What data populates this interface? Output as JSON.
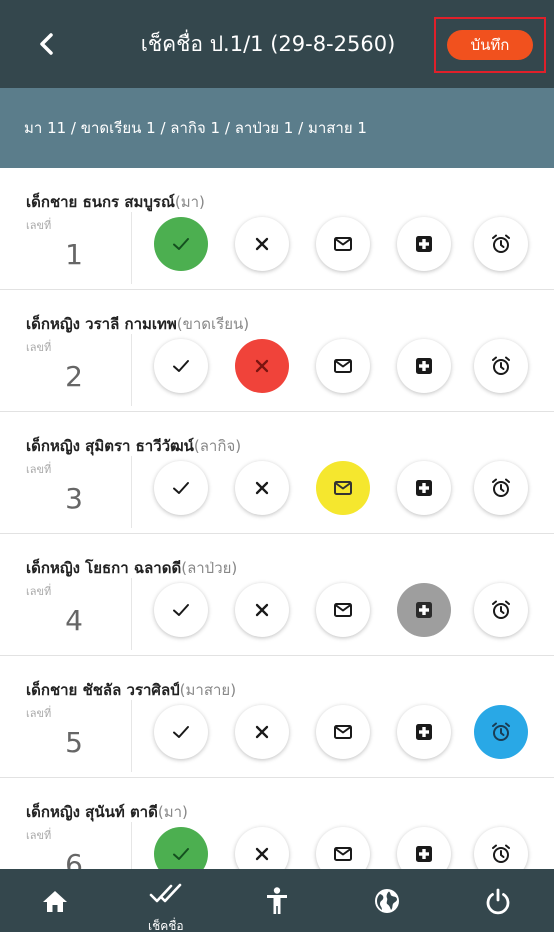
{
  "header": {
    "title": "เช็คชื่อ ป.1/1 (29-8-2560)",
    "save_label": "บันทึก",
    "back_icon": "chevron-left-icon"
  },
  "summary": {
    "text": "มา 11 / ขาดเรียน 1 / ลากิจ 1 / ลาป่วย 1 / มาสาย 1"
  },
  "colors": {
    "header_bg": "#34474d",
    "summary_bg": "#5b7d8b",
    "save": "#f1511e",
    "present": "#4caf50",
    "absent": "#f0433a",
    "leave": "#f5e72e",
    "sick": "#9e9e9e",
    "late": "#29a8e6"
  },
  "no_label": "เลขที่",
  "actions": [
    "present",
    "absent",
    "leave",
    "sick",
    "late"
  ],
  "action_icons": [
    "check-icon",
    "close-icon",
    "envelope-icon",
    "medical-plus-icon",
    "alarm-clock-icon"
  ],
  "students": [
    {
      "name": "เด็กชาย ธนกร สมบูรณ์",
      "status": "(มา)",
      "number": "1",
      "selected": "present"
    },
    {
      "name": "เด็กหญิง วราลี กามเทพ",
      "status": "(ขาดเรียน)",
      "number": "2",
      "selected": "absent"
    },
    {
      "name": "เด็กหญิง สุมิตรา ธาวีวัฒน์",
      "status": "(ลากิจ)",
      "number": "3",
      "selected": "leave"
    },
    {
      "name": "เด็กหญิง โยธกา ฉลาดดี",
      "status": "(ลาป่วย)",
      "number": "4",
      "selected": "sick"
    },
    {
      "name": "เด็กชาย ชัชลัล วราศิลป์",
      "status": "(มาสาย)",
      "number": "5",
      "selected": "late"
    },
    {
      "name": "เด็กหญิง สุนันท์ ตาดี",
      "status": "(มา)",
      "number": "6",
      "selected": "present"
    }
  ],
  "bottom_nav": [
    {
      "icon": "home-icon",
      "label": ""
    },
    {
      "icon": "double-check-icon",
      "label": "เช็คชื่อ",
      "active": true
    },
    {
      "icon": "person-icon",
      "label": ""
    },
    {
      "icon": "globe-icon",
      "label": ""
    },
    {
      "icon": "power-icon",
      "label": ""
    }
  ]
}
